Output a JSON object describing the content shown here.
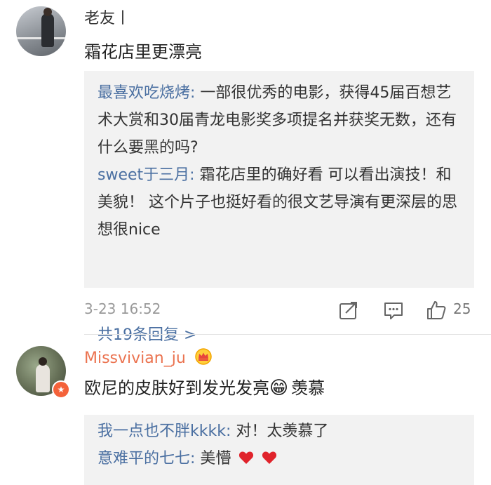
{
  "comment1": {
    "username": "老友丨",
    "text": "霜花店里更漂亮",
    "replies": [
      {
        "name": "最喜欢吃烧烤",
        "sep": ": ",
        "text": "一部很优秀的电影，获得45届百想艺术大赏和30届青龙电影奖多项提名并获奖无数，还有什么要黑的吗?"
      },
      {
        "name": "sweet于三月",
        "sep": ": ",
        "text": "霜花店里的确好看  可以看出演技！和美貌！  这个片子也挺好看的很文艺导演有更深层的思想很nice"
      }
    ],
    "more_replies": "共19条回复 >",
    "time": "3-23 16:52",
    "like_count": "25"
  },
  "comment2": {
    "username": "Missvivian_ju",
    "text": "欧尼的皮肤好到发光发亮",
    "emoji_grin": "😁",
    "text_tail": "羡慕",
    "replies": [
      {
        "name": "我一点也不胖kkkk",
        "sep": ": ",
        "text": "对！太羡慕了"
      },
      {
        "name": "意难平的七七",
        "sep": ": ",
        "text": "美懵"
      }
    ]
  },
  "colors": {
    "link": "#4a6fa1",
    "vip_name": "#eb7350",
    "reply_bg": "#f2f2f2",
    "heart": "#e0232b"
  },
  "icons": [
    "avatar",
    "crown-icon",
    "vip-badge-icon",
    "share-icon",
    "comment-icon",
    "like-icon",
    "heart-icon"
  ]
}
